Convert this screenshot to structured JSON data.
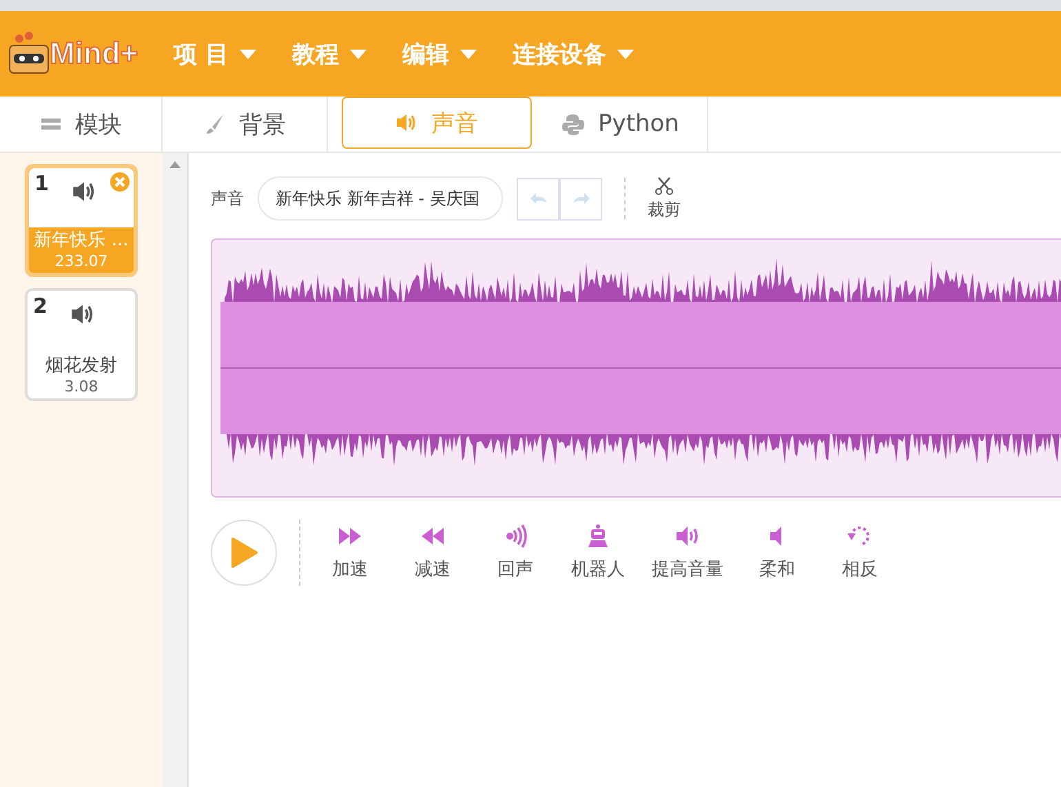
{
  "logo": "Mind+",
  "menu": [
    {
      "label": "项 目"
    },
    {
      "label": "教程"
    },
    {
      "label": "编辑"
    },
    {
      "label": "连接设备"
    }
  ],
  "tabs": [
    {
      "label": "模块",
      "kind": "blocks",
      "selected": false
    },
    {
      "label": "背景",
      "kind": "brush",
      "selected": false
    },
    {
      "label": "声音",
      "kind": "sound",
      "selected": true
    },
    {
      "label": "Python",
      "kind": "python",
      "selected": false
    }
  ],
  "sounds": [
    {
      "number": "1",
      "name": "新年快乐 ...",
      "duration": "233.07",
      "selected": true
    },
    {
      "number": "2",
      "name": "烟花发射",
      "duration": "3.08",
      "selected": false
    }
  ],
  "editor": {
    "sound_label": "声音",
    "sound_name": "新年快乐 新年吉祥 - 吴庆国",
    "trim_label": "裁剪"
  },
  "effects": [
    {
      "kind": "faster",
      "label": "加速"
    },
    {
      "kind": "slower",
      "label": "减速"
    },
    {
      "kind": "echo",
      "label": "回声"
    },
    {
      "kind": "robot",
      "label": "机器人"
    },
    {
      "kind": "louder",
      "label": "提高音量"
    },
    {
      "kind": "softer",
      "label": "柔和"
    },
    {
      "kind": "reverse",
      "label": "相反"
    }
  ]
}
